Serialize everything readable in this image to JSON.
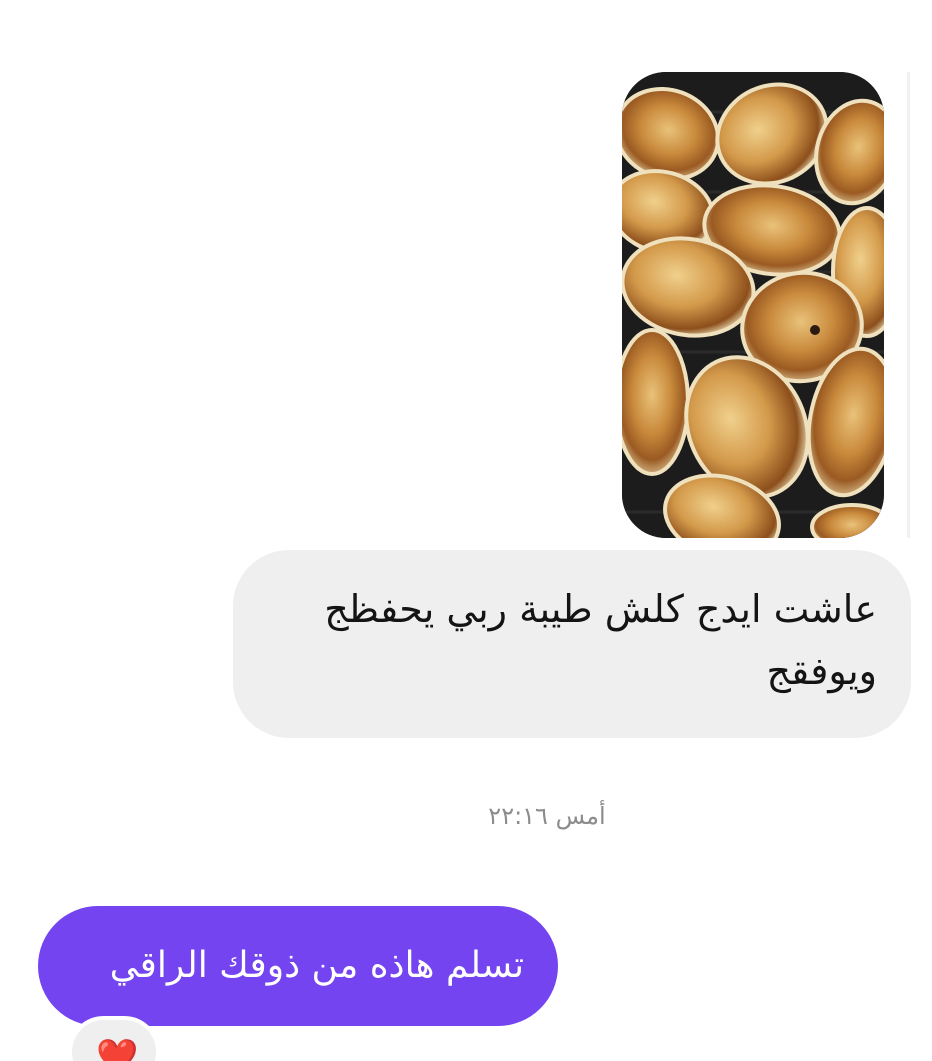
{
  "conversation": {
    "incoming_photo": {
      "icon": "food-photo-pastries"
    },
    "incoming_message": {
      "text": "عاشت ايدج كلش طيبة ربي يحفظج ويوفقج"
    },
    "timestamp": {
      "text": "أمس ٢٢:١٦"
    },
    "outgoing_message": {
      "text": "تسلم هاذه من ذوقك الراقي"
    },
    "reaction": {
      "emoji": "❤️",
      "icon": "red-heart-icon"
    }
  },
  "colors": {
    "background": "#ffffff",
    "incoming_bubble": "#efeff0",
    "outgoing_bubble": "#7344f0",
    "timestamp_text": "#8c8c8c"
  }
}
